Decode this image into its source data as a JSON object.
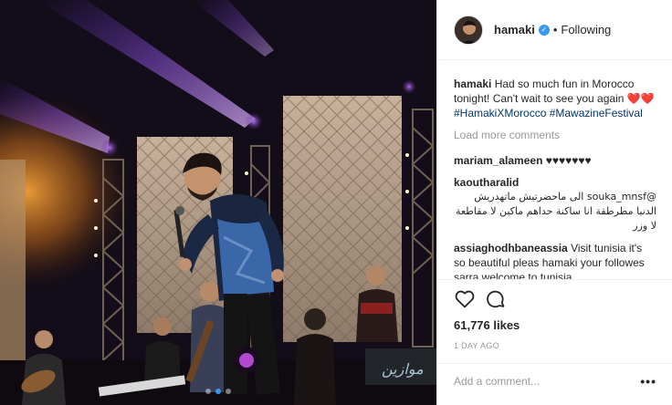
{
  "post": {
    "username": "hamaki",
    "follow_status": "Following",
    "separator": "•",
    "caption": {
      "username": "hamaki",
      "text": "Had so much fun in Morocco tonight! Can't wait to see you again ❤️❤️",
      "hashtags": "#HamakiXMorocco #MawazineFestival"
    },
    "load_more": "Load more comments",
    "comments": [
      {
        "username": "mariam_alameen",
        "text": "♥♥♥♥♥♥♥"
      },
      {
        "username": "kaoutharalid",
        "text": "@souka_mnsf الى ماحضرتيش ماتهدريش الدنيا مطرطقة انا ساكنة حداهم ماكين لا مقاطعة لا وزر"
      },
      {
        "username": "assiaghodhbaneassia",
        "text": "Visit tunisia it's so beautiful pleas hamaki your followes sarra welcome to tunisia"
      }
    ],
    "likes": "61,776 likes",
    "time": "1 DAY AGO",
    "comment_placeholder": "Add a comment...",
    "more_label": "•••"
  },
  "icons": {
    "verified": "verified-badge-icon",
    "like": "heart-icon",
    "comment": "comment-bubble-icon",
    "options": "more-options-icon"
  },
  "colors": {
    "verified": "#3897f0",
    "hashtag": "#003569",
    "muted": "#999999",
    "text": "#262626"
  },
  "carousel": {
    "count": 3,
    "active": 1
  }
}
